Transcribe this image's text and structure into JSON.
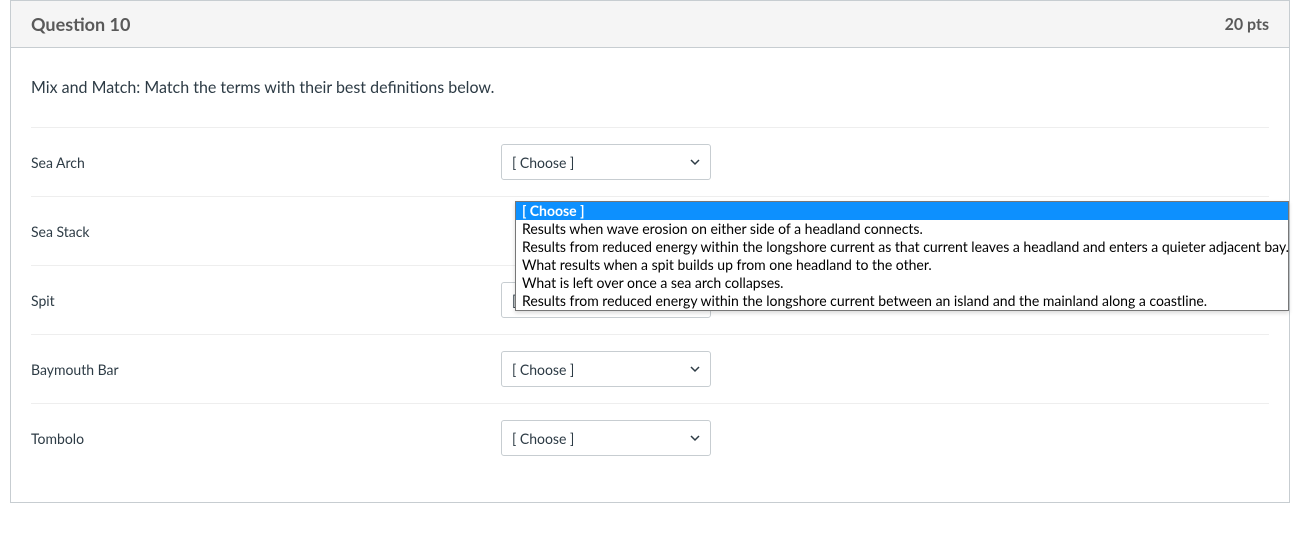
{
  "question": {
    "title": "Question 10",
    "points": "20 pts",
    "instruction": "Mix and Match:  Match the terms with their best definitions below."
  },
  "select_placeholder": "[ Choose ]",
  "terms": [
    {
      "label": "Sea Arch"
    },
    {
      "label": "Sea Stack"
    },
    {
      "label": "Spit"
    },
    {
      "label": "Baymouth Bar"
    },
    {
      "label": "Tombolo"
    }
  ],
  "dropdown_options": [
    "[ Choose ]",
    "Results when wave erosion on either side of a headland connects.",
    "Results from reduced energy within the longshore current as that current leaves a headland and enters a quieter adjacent bay.",
    "What results when a spit builds up from one headland to the other.",
    "What is left over once a sea arch collapses.",
    "Results from reduced energy within the longshore current between an island and the mainland along a coastline."
  ]
}
